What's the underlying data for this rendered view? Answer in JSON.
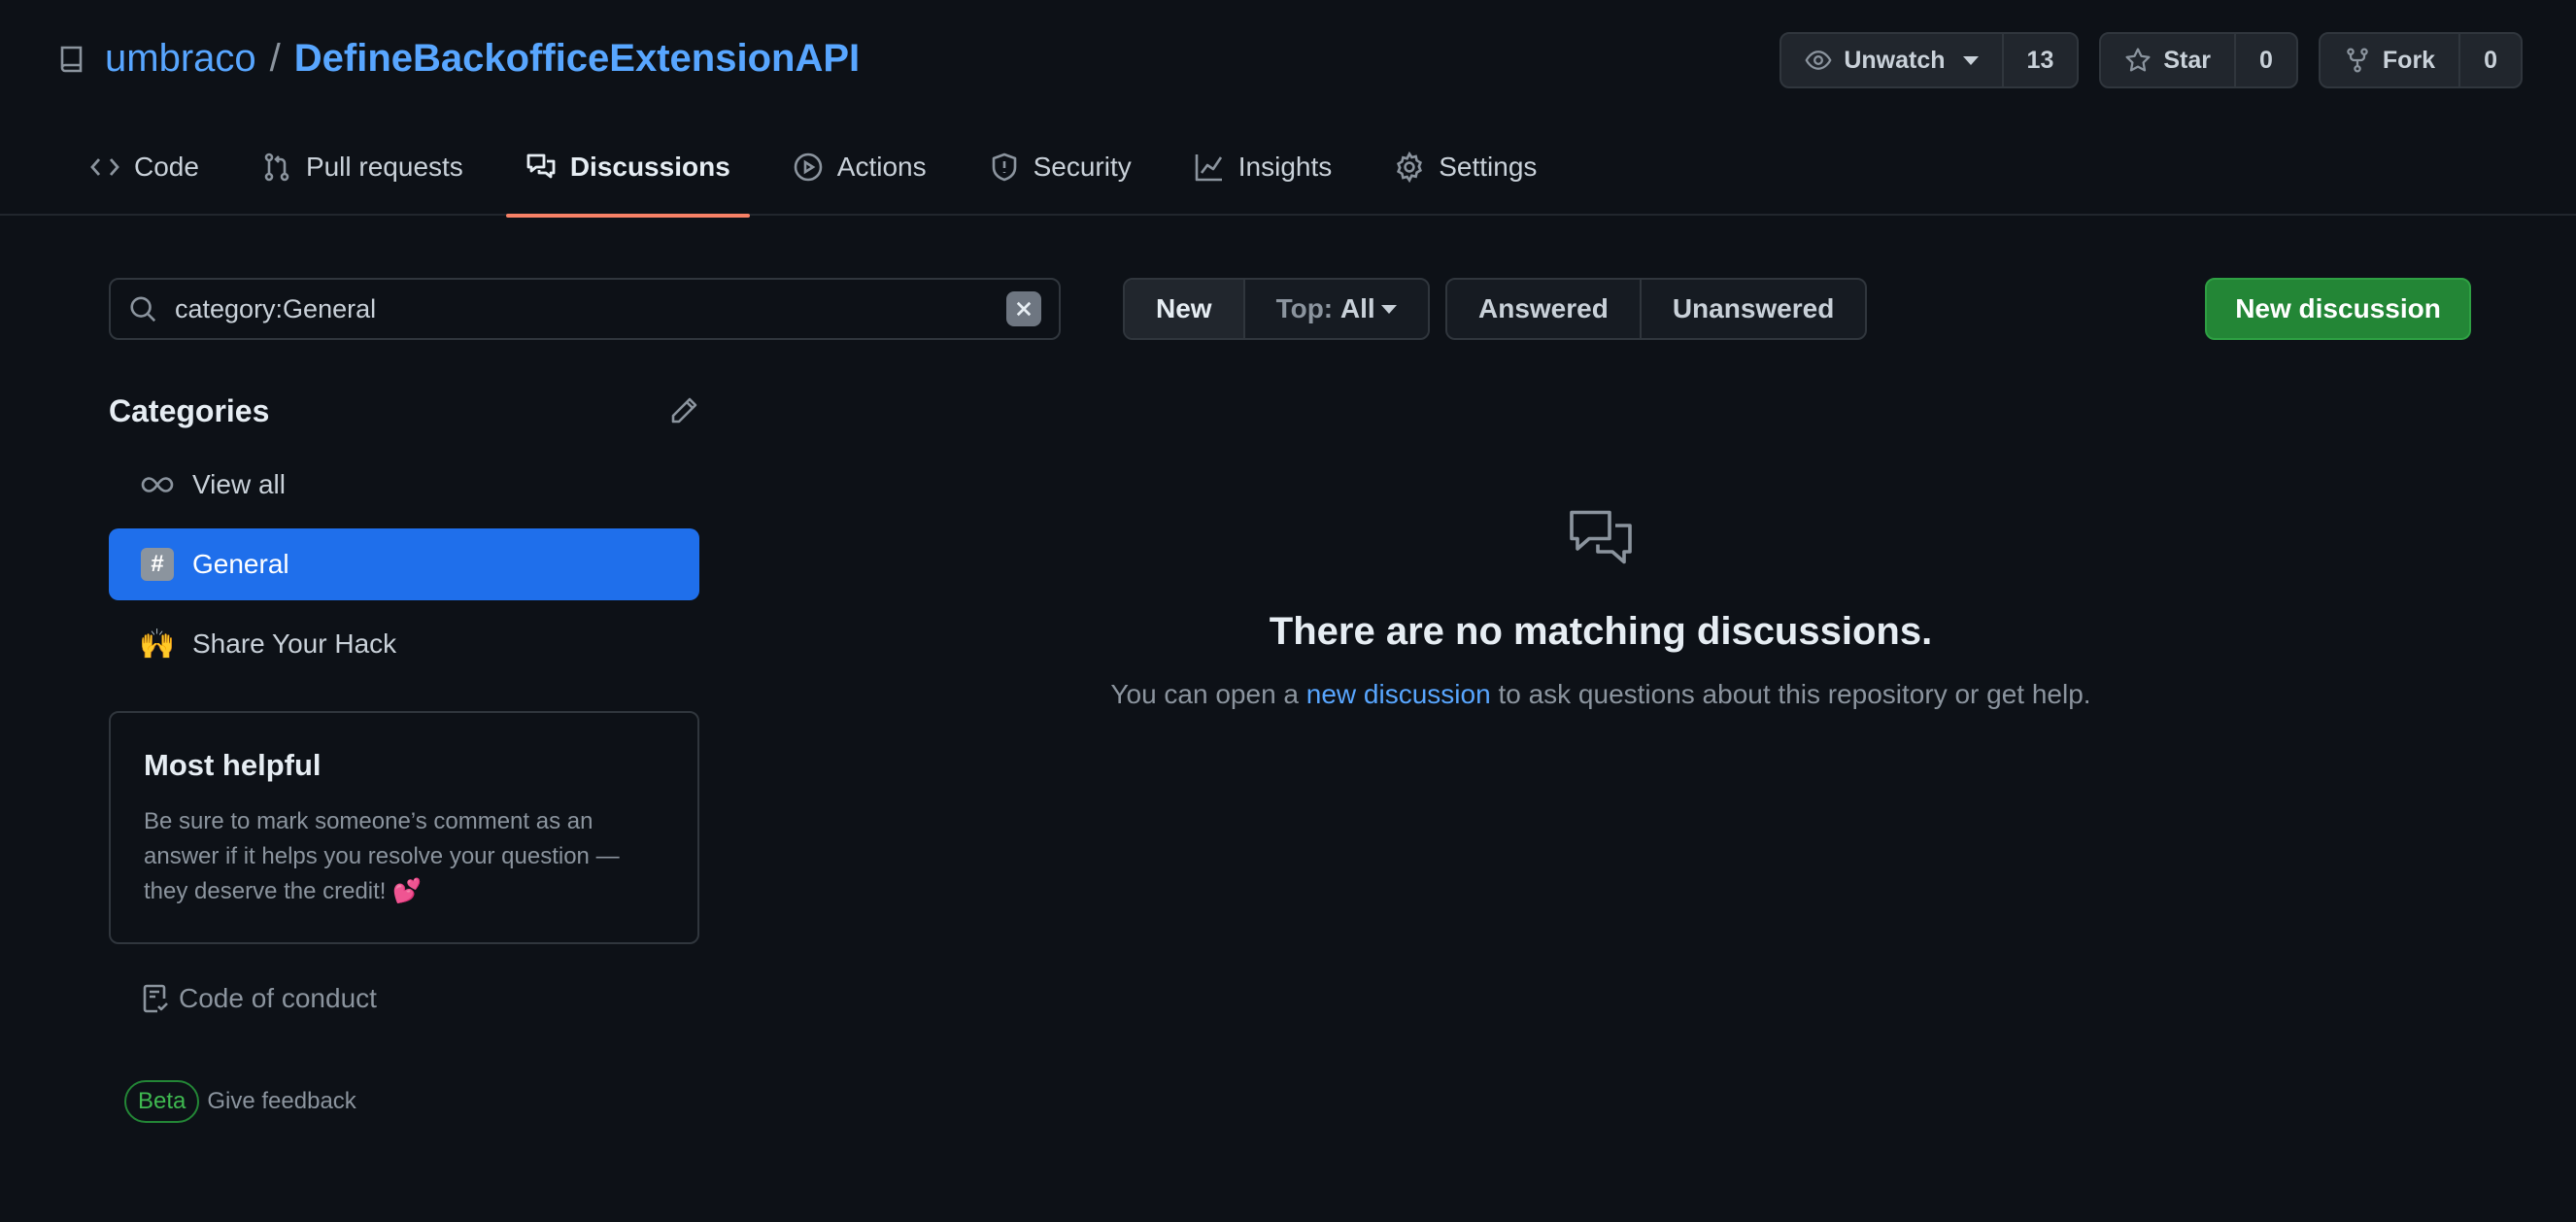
{
  "repo": {
    "owner": "umbraco",
    "separator": "/",
    "name": "DefineBackofficeExtensionAPI",
    "watch_label": "Unwatch",
    "watch_count": "13",
    "star_label": "Star",
    "star_count": "0",
    "fork_label": "Fork",
    "fork_count": "0"
  },
  "tabs": [
    {
      "label": "Code",
      "icon": "code-icon"
    },
    {
      "label": "Pull requests",
      "icon": "pull-request-icon"
    },
    {
      "label": "Discussions",
      "icon": "discussions-icon",
      "active": true
    },
    {
      "label": "Actions",
      "icon": "play-icon"
    },
    {
      "label": "Security",
      "icon": "shield-icon"
    },
    {
      "label": "Insights",
      "icon": "graph-icon"
    },
    {
      "label": "Settings",
      "icon": "gear-icon"
    }
  ],
  "search": {
    "value": "category:General"
  },
  "filters": {
    "new": "New",
    "top_prefix": "Top:",
    "top_value": "All",
    "answered": "Answered",
    "unanswered": "Unanswered"
  },
  "new_discussion_label": "New discussion",
  "sidebar": {
    "categories_title": "Categories",
    "items": [
      {
        "label": "View all",
        "icon": "infinity-icon"
      },
      {
        "label": "General",
        "icon": "hash-icon",
        "selected": true
      },
      {
        "label": "Share Your Hack",
        "icon": "raised-hands-emoji",
        "emoji": "🙌"
      }
    ],
    "helpful": {
      "title": "Most helpful",
      "text": "Be sure to mark someone’s comment as an answer if it helps you resolve your question — they deserve the credit! 💕"
    },
    "code_of_conduct": "Code of conduct",
    "beta_badge": "Beta",
    "feedback": "Give feedback"
  },
  "empty_state": {
    "title": "There are no matching discussions.",
    "text_before": "You can open a",
    "link": "new discussion",
    "text_after": "to ask questions about this repository or get help."
  },
  "colors": {
    "background": "#0d1117",
    "link": "#58a6ff",
    "selected_category": "#1f6feb",
    "primary_button": "#238636",
    "active_tab_underline": "#f78166"
  }
}
